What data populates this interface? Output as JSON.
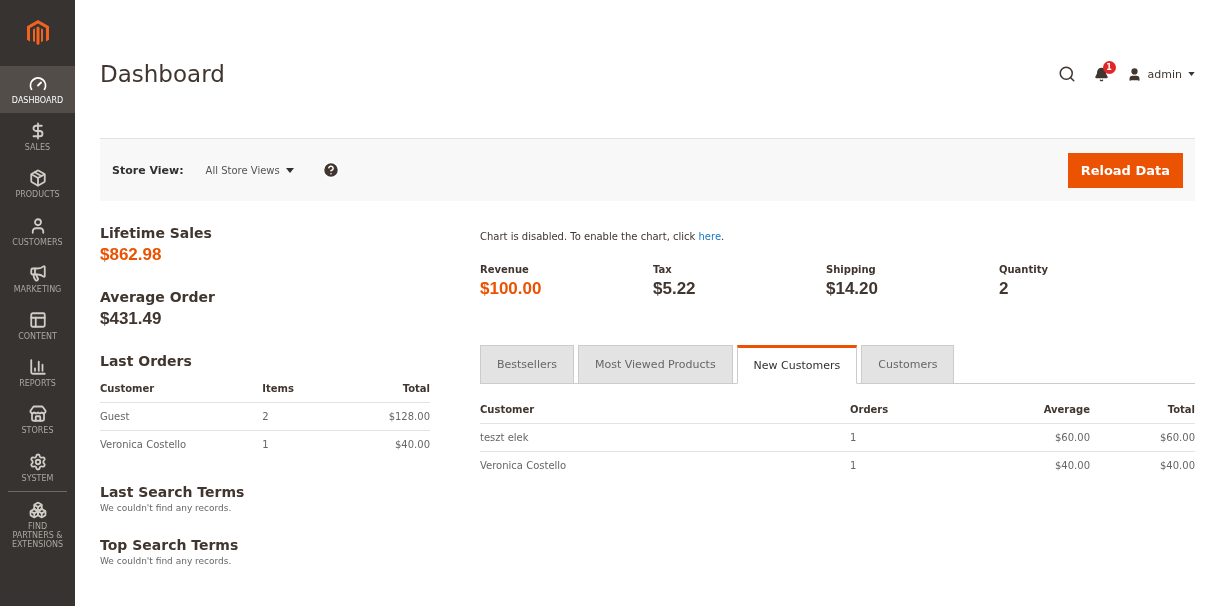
{
  "sidebar": {
    "items": [
      {
        "kind": "dashboard",
        "label": "DASHBOARD",
        "selected": true
      },
      {
        "kind": "sales",
        "label": "SALES",
        "selected": false
      },
      {
        "kind": "products",
        "label": "PRODUCTS",
        "selected": false
      },
      {
        "kind": "customers",
        "label": "CUSTOMERS",
        "selected": false
      },
      {
        "kind": "marketing",
        "label": "MARKETING",
        "selected": false
      },
      {
        "kind": "content",
        "label": "CONTENT",
        "selected": false
      },
      {
        "kind": "reports",
        "label": "REPORTS",
        "selected": false
      },
      {
        "kind": "stores",
        "label": "STORES",
        "selected": false
      },
      {
        "kind": "system",
        "label": "SYSTEM",
        "selected": false
      },
      {
        "kind": "partners",
        "label": "FIND PARTNERS & EXTENSIONS",
        "selected": false
      }
    ]
  },
  "header": {
    "title": "Dashboard",
    "notification_count": "1",
    "user": "admin"
  },
  "store_bar": {
    "label": "Store View:",
    "value": "All Store Views",
    "button": "Reload Data"
  },
  "lifetime_sales": {
    "label": "Lifetime Sales",
    "value": "$862.98"
  },
  "average_order": {
    "label": "Average Order",
    "value": "$431.49"
  },
  "last_orders": {
    "title": "Last Orders",
    "columns": [
      "Customer",
      "Items",
      "Total"
    ],
    "rows": [
      [
        "Guest",
        "2",
        "$128.00"
      ],
      [
        "Veronica Costello",
        "1",
        "$40.00"
      ]
    ]
  },
  "last_search_terms": {
    "title": "Last Search Terms",
    "message": "We couldn't find any records."
  },
  "top_search_terms": {
    "title": "Top Search Terms",
    "message": "We couldn't find any records."
  },
  "chart_notice": {
    "text": "Chart is disabled. To enable the chart, click ",
    "link": "here",
    "after": "."
  },
  "totals": [
    {
      "label": "Revenue",
      "value": "$100.00",
      "highlight": true
    },
    {
      "label": "Tax",
      "value": "$5.22",
      "highlight": false
    },
    {
      "label": "Shipping",
      "value": "$14.20",
      "highlight": false
    },
    {
      "label": "Quantity",
      "value": "2",
      "highlight": false
    }
  ],
  "tabs": [
    {
      "label": "Bestsellers",
      "selected": false
    },
    {
      "label": "Most Viewed Products",
      "selected": false
    },
    {
      "label": "New Customers",
      "selected": true
    },
    {
      "label": "Customers",
      "selected": false
    }
  ],
  "table": {
    "columns": [
      "Customer",
      "Orders",
      "Average",
      "Total"
    ],
    "rows": [
      [
        "teszt elek",
        "1",
        "$60.00",
        "$60.00"
      ],
      [
        "Veronica Costello",
        "1",
        "$40.00",
        "$40.00"
      ]
    ]
  }
}
